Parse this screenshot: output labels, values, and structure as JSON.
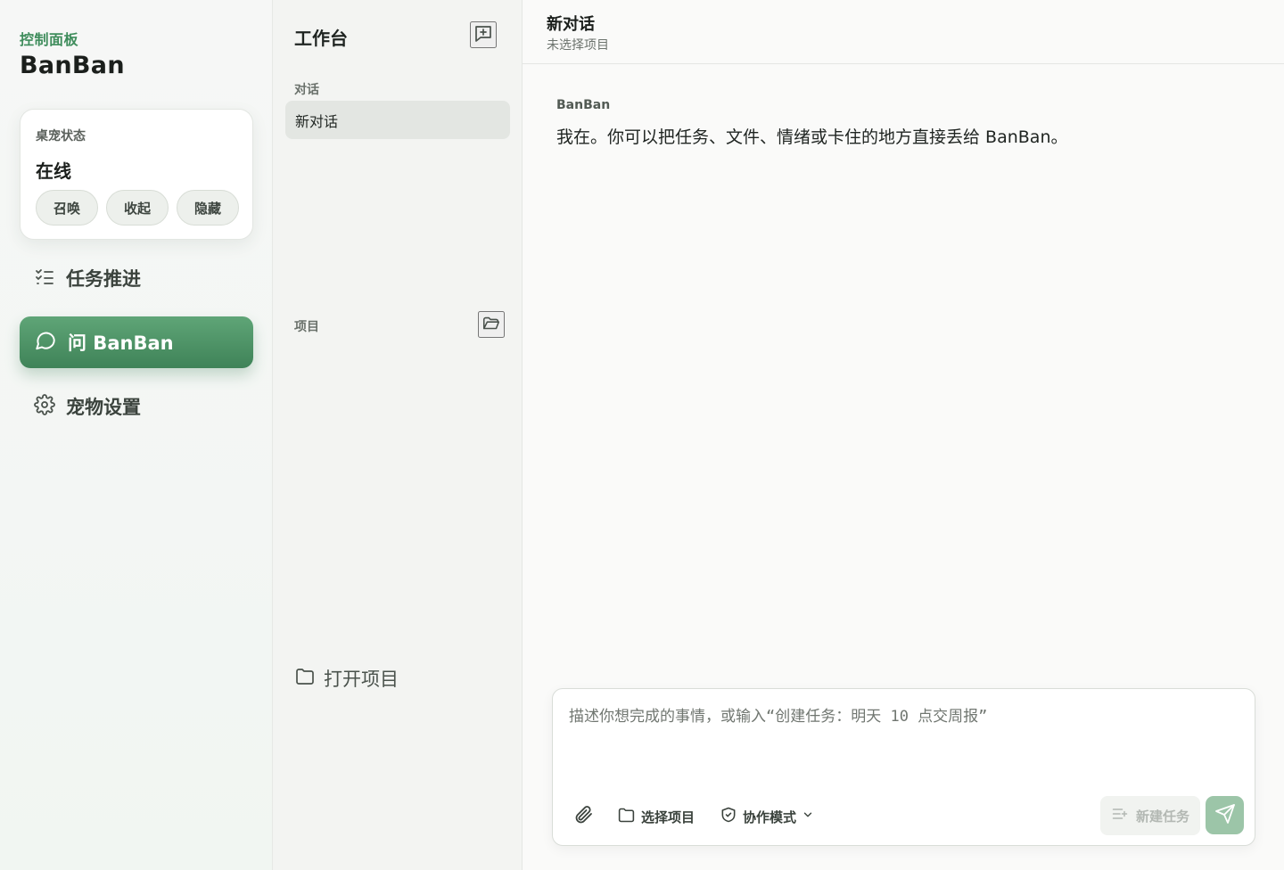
{
  "sidebar": {
    "kicker": "控制面板",
    "title": "BanBan",
    "status_card": {
      "label": "桌宠状态",
      "value": "在线",
      "buttons": [
        {
          "label": "召唤"
        },
        {
          "label": "收起"
        },
        {
          "label": "隐藏"
        }
      ]
    },
    "nav": [
      {
        "label": "任务推进",
        "icon": "checklist-icon",
        "active": false
      },
      {
        "label": "问 BanBan",
        "icon": "chat-bubble-icon",
        "active": true
      },
      {
        "label": "宠物设置",
        "icon": "gear-icon",
        "active": false
      }
    ],
    "accent_color": "#4f9468"
  },
  "workspace": {
    "title": "工作台",
    "new_chat_icon": "message-plus-icon",
    "conversations_label": "对话",
    "conversations": [
      {
        "label": "新对话",
        "selected": true
      }
    ],
    "projects_label": "项目",
    "projects_icon": "folder-open-icon",
    "open_project_label": "打开项目"
  },
  "chat": {
    "title": "新对话",
    "subtitle": "未选择项目",
    "messages": [
      {
        "sender": "BanBan",
        "text": "我在。你可以把任务、文件、情绪或卡住的地方直接丢给 BanBan。"
      }
    ],
    "composer": {
      "placeholder": "描述你想完成的事情，或输入“创建任务：明天 10 点交周报”",
      "value": "",
      "attach_icon": "paperclip-icon",
      "select_project_label": "选择项目",
      "mode_label": "协作模式",
      "new_task_label": "新建任务",
      "send_icon": "send-icon"
    }
  }
}
